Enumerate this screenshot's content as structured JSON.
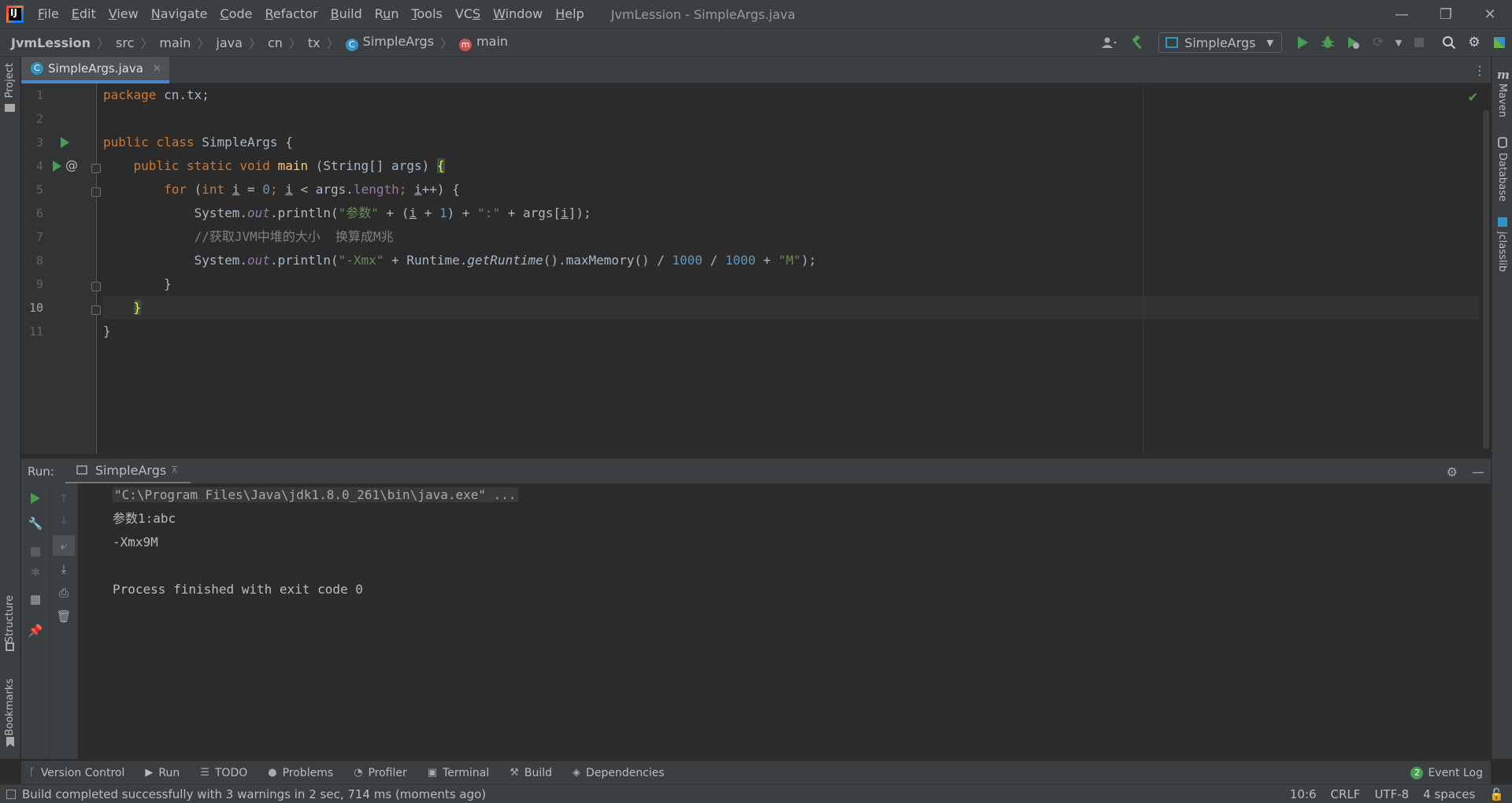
{
  "titlebar": {
    "logo_text": "IJ",
    "menu": [
      {
        "pre": "",
        "mn": "F",
        "post": "ile"
      },
      {
        "pre": "",
        "mn": "E",
        "post": "dit"
      },
      {
        "pre": "",
        "mn": "V",
        "post": "iew"
      },
      {
        "pre": "",
        "mn": "N",
        "post": "avigate"
      },
      {
        "pre": "",
        "mn": "C",
        "post": "ode"
      },
      {
        "pre": "",
        "mn": "R",
        "post": "efactor"
      },
      {
        "pre": "",
        "mn": "B",
        "post": "uild"
      },
      {
        "pre": "R",
        "mn": "u",
        "post": "n"
      },
      {
        "pre": "",
        "mn": "T",
        "post": "ools"
      },
      {
        "pre": "VC",
        "mn": "S",
        "post": ""
      },
      {
        "pre": "",
        "mn": "W",
        "post": "indow"
      },
      {
        "pre": "",
        "mn": "H",
        "post": "elp"
      }
    ],
    "window_title": "JvmLession - SimpleArgs.java",
    "controls": {
      "minimize": "—",
      "restore": "❐",
      "close": "✕"
    }
  },
  "navbar": {
    "breadcrumb": [
      "JvmLession",
      "src",
      "main",
      "java",
      "cn",
      "tx",
      "SimpleArgs",
      "main"
    ],
    "separator": "〉",
    "class_icon_letter": "C",
    "method_icon_letter": "m",
    "run_config": "SimpleArgs"
  },
  "sidebars": {
    "left": {
      "project": "Project",
      "structure": "Structure",
      "bookmarks": "Bookmarks"
    },
    "right": {
      "maven": "Maven",
      "database": "Database",
      "jclasslib": "jclasslib"
    }
  },
  "editor": {
    "tab": {
      "title": "SimpleArgs.java",
      "icon_letter": "C",
      "close": "✕"
    },
    "line_numbers": [
      "1",
      "2",
      "3",
      "4",
      "5",
      "6",
      "7",
      "8",
      "9",
      "10",
      "11"
    ],
    "current_line": "10",
    "gutter_marker": "@",
    "code_text": {
      "l1": [
        "package",
        " cn.tx;"
      ],
      "l3": [
        "public class",
        " SimpleArgs {"
      ],
      "l4": [
        "    ",
        "public static void",
        " ",
        "main",
        " (String[] args) ",
        "{"
      ],
      "l5": [
        "        ",
        "for",
        " (",
        "int",
        " ",
        "i",
        " = ",
        "0",
        "; ",
        "i",
        " < args.",
        "length",
        "; ",
        "i",
        "++) {"
      ],
      "l6": [
        "            System.",
        "out",
        ".println(",
        "\"参数\"",
        " + (",
        "i",
        " + ",
        "1",
        ") + ",
        "\":\"",
        " + args[",
        "i",
        "]);"
      ],
      "l7": [
        "            ",
        "//获取JVM中堆的大小  换算成M兆"
      ],
      "l8": [
        "            System.",
        "out",
        ".println(",
        "\"-Xmx\"",
        " + Runtime.",
        "getRuntime",
        "().maxMemory() / ",
        "1000",
        " / ",
        "1000",
        " + ",
        "\"M\"",
        ");"
      ],
      "l9": [
        "        }"
      ],
      "l10": [
        "    ",
        "}"
      ],
      "l11": [
        "}"
      ]
    }
  },
  "run_panel": {
    "label": "Run:",
    "tab": "SimpleArgs",
    "tab_pin": "⊼",
    "console": [
      "\"C:\\Program Files\\Java\\jdk1.8.0_261\\bin\\java.exe\" ...",
      "参数1:abc",
      "-Xmx9M",
      "",
      "Process finished with exit code 0"
    ]
  },
  "tool_windows": [
    {
      "name": "Version Control",
      "icon": "ᚴ"
    },
    {
      "name": "Run",
      "icon": "▶"
    },
    {
      "name": "TODO",
      "icon": "☰"
    },
    {
      "name": "Problems",
      "icon": "●"
    },
    {
      "name": "Profiler",
      "icon": "◔"
    },
    {
      "name": "Terminal",
      "icon": "▣"
    },
    {
      "name": "Build",
      "icon": "⚒"
    },
    {
      "name": "Dependencies",
      "icon": "◈"
    }
  ],
  "event_log": {
    "count": "2",
    "label": "Event Log"
  },
  "statusbar": {
    "message": "Build completed successfully with 3 warnings in 2 sec, 714 ms (moments ago)",
    "position": "10:6",
    "line_sep": "CRLF",
    "encoding": "UTF-8",
    "indent": "4 spaces"
  },
  "colors": {
    "run_green": "#499c54",
    "accent_blue": "#4a88c7",
    "keyword": "#cc7832",
    "string": "#6a8759",
    "number": "#6897bb",
    "field": "#9876aa",
    "method": "#ffc66d"
  }
}
